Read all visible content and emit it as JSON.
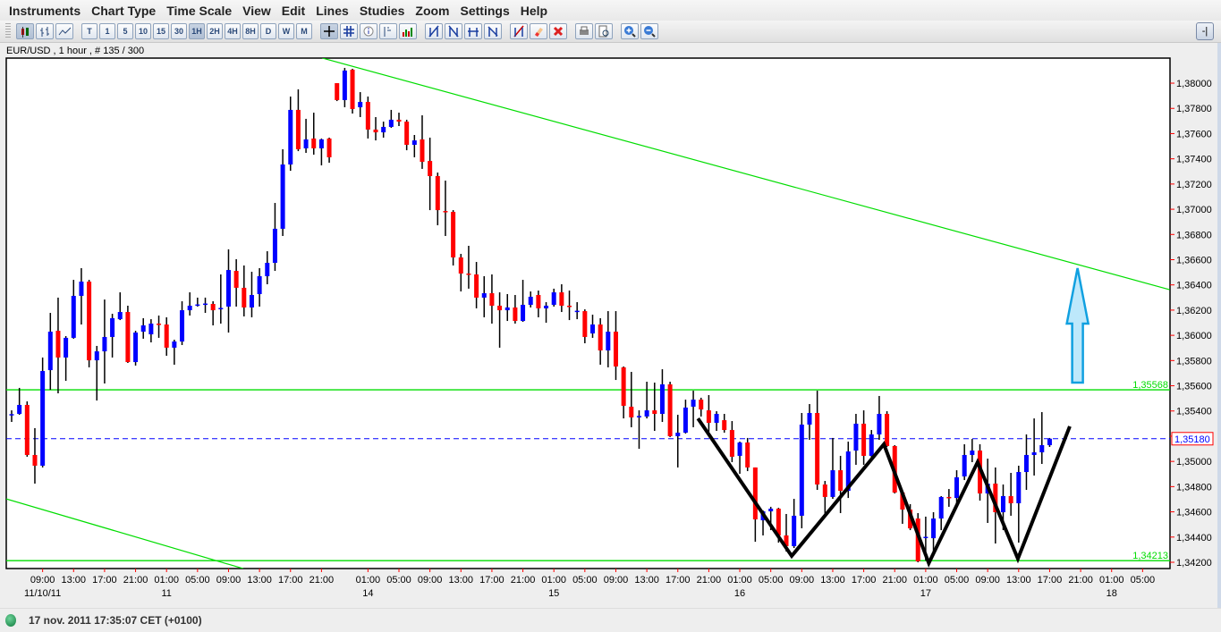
{
  "menu": [
    "Instruments",
    "Chart Type",
    "Time Scale",
    "View",
    "Edit",
    "Lines",
    "Studies",
    "Zoom",
    "Settings",
    "Help"
  ],
  "toolbar": {
    "chart_types": [
      "candlestick-chart-icon",
      "bar-chart-icon",
      "line-chart-icon"
    ],
    "timescales": [
      "T",
      "1",
      "5",
      "10",
      "15",
      "30",
      "1H",
      "2H",
      "4H",
      "8H",
      "D",
      "W",
      "M"
    ],
    "active_timescale": "1H",
    "tools": [
      "crosshair-icon",
      "grid-icon",
      "info-icon",
      "price-marker-icon",
      "volume-icon"
    ],
    "line_tools": [
      "trendline-icon",
      "parallel-lines-icon",
      "horizontal-lines-icon",
      "fibonacci-icon"
    ],
    "edit_tools": [
      "delete-line-icon",
      "eraser-icon",
      "delete-all-icon"
    ],
    "print_tools": [
      "print-icon",
      "print-preview-icon"
    ],
    "zoom_tools": [
      "zoom-in-icon",
      "zoom-out-icon"
    ],
    "pin_label": "-|"
  },
  "chart_title": "EUR/USD , 1 hour , # 135 / 300",
  "status": {
    "text": "17 nov. 2011 17:35:07  CET (+0100)",
    "led_color": "#1a9a50"
  },
  "colors": {
    "up": "#0000ff",
    "down": "#ff0000",
    "trend": "#00dd00",
    "level": "#00dd00",
    "last_price": "#0000ff",
    "pattern": "#000000",
    "arrow_fill": "#bde8fb",
    "arrow_stroke": "#10a0e0",
    "tick": "#ff0000"
  },
  "chart_data": {
    "type": "candlestick",
    "symbol": "EUR/USD",
    "timeframe": "1 hour",
    "ylim": [
      1.3415,
      1.38199
    ],
    "xlim_index": [
      -0.7,
      149.5
    ],
    "y_ticks": [
      "1,38000",
      "1,37800",
      "1,37600",
      "1,37400",
      "1,37200",
      "1,37000",
      "1,36800",
      "1,36600",
      "1,36400",
      "1,36200",
      "1,36000",
      "1,35800",
      "1,35600",
      "1,35400",
      "1,35200",
      "1,35000",
      "1,34800",
      "1,34600",
      "1,34400",
      "1,34200"
    ],
    "y_tick_values": [
      1.38,
      1.378,
      1.376,
      1.374,
      1.372,
      1.37,
      1.368,
      1.366,
      1.364,
      1.362,
      1.36,
      1.358,
      1.356,
      1.354,
      1.352,
      1.35,
      1.348,
      1.346,
      1.344,
      1.342
    ],
    "x_time_labels": [
      {
        "i": 4,
        "t": "09:00"
      },
      {
        "i": 8,
        "t": "13:00"
      },
      {
        "i": 12,
        "t": "17:00"
      },
      {
        "i": 16,
        "t": "21:00"
      },
      {
        "i": 20,
        "t": "01:00"
      },
      {
        "i": 24,
        "t": "05:00"
      },
      {
        "i": 28,
        "t": "09:00"
      },
      {
        "i": 32,
        "t": "13:00"
      },
      {
        "i": 36,
        "t": "17:00"
      },
      {
        "i": 40,
        "t": "21:00"
      },
      {
        "i": 46,
        "t": "01:00"
      },
      {
        "i": 50,
        "t": "05:00"
      },
      {
        "i": 54,
        "t": "09:00"
      },
      {
        "i": 58,
        "t": "13:00"
      },
      {
        "i": 62,
        "t": "17:00"
      },
      {
        "i": 66,
        "t": "21:00"
      },
      {
        "i": 70,
        "t": "01:00"
      },
      {
        "i": 74,
        "t": "05:00"
      },
      {
        "i": 78,
        "t": "09:00"
      },
      {
        "i": 82,
        "t": "13:00"
      },
      {
        "i": 86,
        "t": "17:00"
      },
      {
        "i": 90,
        "t": "21:00"
      },
      {
        "i": 94,
        "t": "01:00"
      },
      {
        "i": 98,
        "t": "05:00"
      },
      {
        "i": 102,
        "t": "09:00"
      },
      {
        "i": 106,
        "t": "13:00"
      },
      {
        "i": 110,
        "t": "17:00"
      },
      {
        "i": 114,
        "t": "21:00"
      },
      {
        "i": 118,
        "t": "01:00"
      },
      {
        "i": 122,
        "t": "05:00"
      },
      {
        "i": 126,
        "t": "09:00"
      },
      {
        "i": 130,
        "t": "13:00"
      },
      {
        "i": 134,
        "t": "17:00"
      },
      {
        "i": 138,
        "t": "21:00"
      },
      {
        "i": 142,
        "t": "01:00"
      },
      {
        "i": 146,
        "t": "05:00"
      }
    ],
    "x_date_labels": [
      {
        "i": 4,
        "t": "11/10/11"
      },
      {
        "i": 20,
        "t": "11"
      },
      {
        "i": 46,
        "t": "14"
      },
      {
        "i": 70,
        "t": "15"
      },
      {
        "i": 94,
        "t": "16"
      },
      {
        "i": 118,
        "t": "17"
      },
      {
        "i": 142,
        "t": "18"
      }
    ],
    "candles_ohlc": [
      [
        1.3537,
        1.35405,
        1.35313,
        1.35375
      ],
      [
        1.35377,
        1.35583,
        1.3537,
        1.35448
      ],
      [
        1.35448,
        1.35476,
        1.35037,
        1.35051
      ],
      [
        1.35051,
        1.35264,
        1.34824,
        1.34966
      ],
      [
        1.34966,
        1.35824,
        1.34952,
        1.35717
      ],
      [
        1.35724,
        1.36178,
        1.35568,
        1.36029
      ],
      [
        1.36036,
        1.36299,
        1.3554,
        1.35824
      ],
      [
        1.35824,
        1.35994,
        1.35639,
        1.3598
      ],
      [
        1.3598,
        1.3644,
        1.35973,
        1.36313
      ],
      [
        1.36313,
        1.36533,
        1.36086,
        1.36426
      ],
      [
        1.36426,
        1.3644,
        1.35746,
        1.35802
      ],
      [
        1.35802,
        1.35916,
        1.35483,
        1.35873
      ],
      [
        1.35873,
        1.36284,
        1.35618,
        1.35987
      ],
      [
        1.35987,
        1.36171,
        1.35824,
        1.36136
      ],
      [
        1.36128,
        1.36341,
        1.36121,
        1.36185
      ],
      [
        1.36185,
        1.36235,
        1.35781,
        1.35788
      ],
      [
        1.35788,
        1.36036,
        1.3576,
        1.36022
      ],
      [
        1.36029,
        1.36136,
        1.35973,
        1.36079
      ],
      [
        1.36008,
        1.36128,
        1.35944,
        1.36093
      ],
      [
        1.36093,
        1.36157,
        1.3598,
        1.3609
      ],
      [
        1.36086,
        1.36143,
        1.35838,
        1.35902
      ],
      [
        1.35902,
        1.35965,
        1.35767,
        1.35951
      ],
      [
        1.35951,
        1.3627,
        1.35923,
        1.36199
      ],
      [
        1.36199,
        1.36341,
        1.36157,
        1.36235
      ],
      [
        1.36242,
        1.36299,
        1.36228,
        1.36245
      ],
      [
        1.36249,
        1.36299,
        1.36178,
        1.36252
      ],
      [
        1.36249,
        1.3627,
        1.36079,
        1.36199
      ],
      [
        1.36214,
        1.36483,
        1.36093,
        1.36217
      ],
      [
        1.36228,
        1.36682,
        1.36022,
        1.36518
      ],
      [
        1.36511,
        1.36604,
        1.36228,
        1.36377
      ],
      [
        1.36377,
        1.36554,
        1.3615,
        1.36221
      ],
      [
        1.36221,
        1.36504,
        1.36143,
        1.3632
      ],
      [
        1.36327,
        1.36533,
        1.36228,
        1.36469
      ],
      [
        1.36469,
        1.36667,
        1.36405,
        1.36575
      ],
      [
        1.36575,
        1.3705,
        1.36511,
        1.36845
      ],
      [
        1.36845,
        1.37476,
        1.36788,
        1.37355
      ],
      [
        1.37355,
        1.37894,
        1.37305,
        1.37788
      ],
      [
        1.37788,
        1.37951,
        1.37461,
        1.37476
      ],
      [
        1.37483,
        1.37717,
        1.37447,
        1.37554
      ],
      [
        1.37561,
        1.37766,
        1.37433,
        1.37483
      ],
      [
        1.37483,
        1.37561,
        1.37348,
        1.37554
      ],
      [
        1.37561,
        1.37568,
        1.37369,
        1.37412
      ],
      [
        1.38,
        1.38,
        1.37858,
        1.37866
      ],
      [
        1.37866,
        1.38121,
        1.37809,
        1.381
      ],
      [
        1.38107,
        1.38114,
        1.37759,
        1.37795
      ],
      [
        1.37809,
        1.37929,
        1.37731,
        1.37851
      ],
      [
        1.37851,
        1.37894,
        1.37561,
        1.37632
      ],
      [
        1.37632,
        1.37731,
        1.37546,
        1.3761
      ],
      [
        1.3761,
        1.37695,
        1.37568,
        1.37653
      ],
      [
        1.37653,
        1.37788,
        1.37646,
        1.3771
      ],
      [
        1.3771,
        1.37766,
        1.3766,
        1.37695
      ],
      [
        1.37695,
        1.3771,
        1.37468,
        1.37511
      ],
      [
        1.37511,
        1.37589,
        1.37412,
        1.37546
      ],
      [
        1.37554,
        1.37745,
        1.3732,
        1.37376
      ],
      [
        1.37383,
        1.37568,
        1.36993,
        1.37263
      ],
      [
        1.37263,
        1.37291,
        1.36873,
        1.36993
      ],
      [
        1.36986,
        1.37227,
        1.36788,
        1.3698
      ],
      [
        1.36979,
        1.36993,
        1.36554,
        1.36618
      ],
      [
        1.36618,
        1.36646,
        1.36348,
        1.3649
      ],
      [
        1.3649,
        1.3671,
        1.3637,
        1.36485
      ],
      [
        1.36483,
        1.36582,
        1.36214,
        1.36299
      ],
      [
        1.36299,
        1.36469,
        1.36143,
        1.36334
      ],
      [
        1.36334,
        1.36483,
        1.36093,
        1.36235
      ],
      [
        1.36235,
        1.36341,
        1.35902,
        1.36199
      ],
      [
        1.36199,
        1.36327,
        1.36114,
        1.36221
      ],
      [
        1.36221,
        1.3632,
        1.36093,
        1.36114
      ],
      [
        1.36114,
        1.3644,
        1.36107,
        1.36242
      ],
      [
        1.36242,
        1.36348,
        1.36221,
        1.36306
      ],
      [
        1.3632,
        1.36355,
        1.36143,
        1.36214
      ],
      [
        1.36214,
        1.36263,
        1.361,
        1.36235
      ],
      [
        1.36242,
        1.3637,
        1.36228,
        1.36341
      ],
      [
        1.36341,
        1.36405,
        1.36185,
        1.36235
      ],
      [
        1.36235,
        1.36355,
        1.36121,
        1.36232
      ],
      [
        1.36192,
        1.36263,
        1.36128,
        1.36195
      ],
      [
        1.36192,
        1.36206,
        1.35937,
        1.35987
      ],
      [
        1.36015,
        1.36164,
        1.3598,
        1.36086
      ],
      [
        1.36086,
        1.36136,
        1.35767,
        1.3588
      ],
      [
        1.3588,
        1.36192,
        1.35746,
        1.36029
      ],
      [
        1.36029,
        1.36192,
        1.35646,
        1.35753
      ],
      [
        1.35746,
        1.35753,
        1.35341,
        1.35441
      ],
      [
        1.35434,
        1.3571,
        1.35271,
        1.35349
      ],
      [
        1.35356,
        1.35405,
        1.351,
        1.3536
      ],
      [
        1.35356,
        1.35632,
        1.35341,
        1.35405
      ],
      [
        1.35405,
        1.35625,
        1.35242,
        1.35377
      ],
      [
        1.35377,
        1.35731,
        1.35313,
        1.35611
      ],
      [
        1.35611,
        1.35632,
        1.35193,
        1.352
      ],
      [
        1.352,
        1.3537,
        1.34952,
        1.35228
      ],
      [
        1.35228,
        1.3549,
        1.35221,
        1.35427
      ],
      [
        1.35434,
        1.35561,
        1.35271,
        1.3549
      ],
      [
        1.3549,
        1.35505,
        1.35356,
        1.35412
      ],
      [
        1.35405,
        1.35526,
        1.35235,
        1.35306
      ],
      [
        1.35306,
        1.35398,
        1.35242,
        1.35377
      ],
      [
        1.35327,
        1.35377,
        1.35228,
        1.35249
      ],
      [
        1.35249,
        1.3532,
        1.34994,
        1.35037
      ],
      [
        1.35044,
        1.35157,
        1.34902,
        1.3515
      ],
      [
        1.3515,
        1.35186,
        1.34923,
        1.34952
      ],
      [
        1.34952,
        1.34952,
        1.34363,
        1.3454
      ],
      [
        1.34533,
        1.34611,
        1.34413,
        1.34604
      ],
      [
        1.34604,
        1.3464,
        1.34455,
        1.34625
      ],
      [
        1.34625,
        1.34632,
        1.34356,
        1.34413
      ],
      [
        1.34413,
        1.34583,
        1.34285,
        1.34328
      ],
      [
        1.34328,
        1.34703,
        1.34313,
        1.34569
      ],
      [
        1.34569,
        1.35384,
        1.34469,
        1.35292
      ],
      [
        1.35292,
        1.35455,
        1.35171,
        1.35384
      ],
      [
        1.35384,
        1.35561,
        1.34774,
        1.34817
      ],
      [
        1.34817,
        1.34845,
        1.34569,
        1.34718
      ],
      [
        1.34718,
        1.35186,
        1.34703,
        1.3493
      ],
      [
        1.3493,
        1.35044,
        1.3459,
        1.34767
      ],
      [
        1.34767,
        1.35157,
        1.3471,
        1.35079
      ],
      [
        1.35086,
        1.35377,
        1.34973,
        1.35299
      ],
      [
        1.35299,
        1.35405,
        1.34973,
        1.35044
      ],
      [
        1.35044,
        1.35249,
        1.35022,
        1.35214
      ],
      [
        1.35214,
        1.35519,
        1.35171,
        1.35377
      ],
      [
        1.35377,
        1.35398,
        1.35115,
        1.35122
      ],
      [
        1.35122,
        1.35129,
        1.34746,
        1.34753
      ],
      [
        1.34753,
        1.34753,
        1.34505,
        1.34618
      ],
      [
        1.34618,
        1.34661,
        1.34455,
        1.34469
      ],
      [
        1.34547,
        1.3459,
        1.342,
        1.34207
      ],
      [
        1.34399,
        1.34562,
        1.34214,
        1.34402
      ],
      [
        1.34391,
        1.34597,
        1.34285,
        1.34547
      ],
      [
        1.34547,
        1.34725,
        1.34455,
        1.34718
      ],
      [
        1.34718,
        1.34781,
        1.3464,
        1.34715
      ],
      [
        1.3471,
        1.3493,
        1.3464,
        1.34874
      ],
      [
        1.34881,
        1.35136,
        1.34852,
        1.35051
      ],
      [
        1.35051,
        1.35178,
        1.34994,
        1.35086
      ],
      [
        1.35086,
        1.35136,
        1.34689,
        1.34746
      ],
      [
        1.34746,
        1.35022,
        1.34512,
        1.34824
      ],
      [
        1.34824,
        1.34952,
        1.34349,
        1.34597
      ],
      [
        1.34597,
        1.34817,
        1.34455,
        1.34725
      ],
      [
        1.34725,
        1.34909,
        1.34569,
        1.34668
      ],
      [
        1.34668,
        1.34966,
        1.34356,
        1.34916
      ],
      [
        1.34916,
        1.35214,
        1.34774,
        1.35051
      ],
      [
        1.35051,
        1.35341,
        1.34888,
        1.35072
      ],
      [
        1.35072,
        1.35391,
        1.3498,
        1.35129
      ],
      [
        1.35129,
        1.35186,
        1.35115,
        1.3518
      ]
    ],
    "horizontal_levels": [
      {
        "price": 1.35568,
        "label": "1,35568"
      },
      {
        "price": 1.34213,
        "label": "1,34213"
      }
    ],
    "last_price": {
      "price": 1.3518,
      "label": "1,35180"
    },
    "trendlines": [
      {
        "from": [
          40.1,
          1.38199
        ],
        "to": [
          149.5,
          1.36362
        ]
      },
      {
        "from": [
          -0.7,
          1.34703
        ],
        "to": [
          29.9,
          1.3415
        ]
      }
    ],
    "pattern_polyline": [
      [
        88.6,
        1.35341
      ],
      [
        100.7,
        1.3425
      ],
      [
        112.6,
        1.35136
      ],
      [
        118.4,
        1.34193
      ],
      [
        124.7,
        1.34994
      ],
      [
        129.9,
        1.34228
      ],
      [
        136.6,
        1.35278
      ]
    ],
    "arrow": {
      "index": 137.6,
      "from_price": 1.35625,
      "to_price": 1.36533
    }
  }
}
